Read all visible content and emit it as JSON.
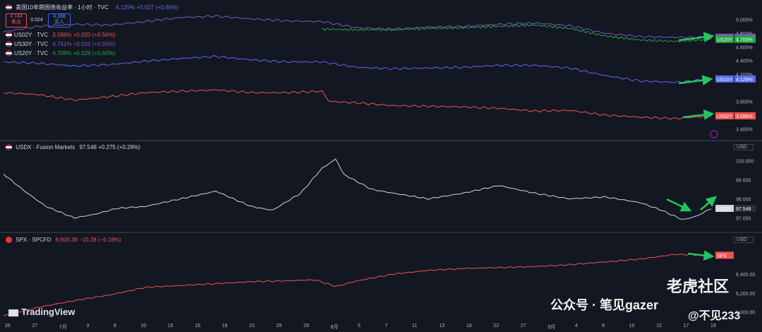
{
  "panels": [
    {
      "id": "yields",
      "legend_main": "美国10年期国债收益率 · 1小时 · TVC",
      "legend_main_value": "4.129% +0.027 (+0.66%)",
      "sell_price": "4.144",
      "sell_label": "卖出",
      "spread": "0.024",
      "buy_price": "4.168",
      "buy_label": "买入",
      "subs": [
        {
          "symbol": "US02Y · TVC",
          "value": "3.586% +0.020 (+0.56%)",
          "color": "#ef5350"
        },
        {
          "symbol": "US30Y · TVC",
          "value": "4.741% +0.026 (+0.55%)",
          "color": "#7e57c2"
        },
        {
          "symbol": "US20Y · TVC",
          "value": "4.709% +0.028 (+0.60%)",
          "color": "#26a641"
        }
      ]
    },
    {
      "id": "usdx",
      "legend_main": "USDX · Fusion Markets",
      "legend_main_value": "97.548 +0.275 (+0.28%)",
      "currency": "USD"
    },
    {
      "id": "spx",
      "legend_main": "SPX · SPCFD",
      "legend_main_value": "6,600.36 −10.28 (−0.16%)",
      "currency": "USD"
    }
  ],
  "chart_data": [
    {
      "type": "line",
      "title": "美国10年期国债收益率 · 1小时 · TVC",
      "ylim": [
        3.3,
        5.1
      ],
      "y_ticks": [
        "5.000%",
        "4.800%",
        "4.600%",
        "4.400%",
        "4.200%",
        "3.800%",
        "3.400%"
      ],
      "series": [
        {
          "name": "US30Y",
          "color": "#7e57c2",
          "last_label": "4.741%",
          "x": [
            0,
            0.05,
            0.1,
            0.15,
            0.2,
            0.25,
            0.3,
            0.35,
            0.4,
            0.45,
            0.5,
            0.55,
            0.6,
            0.65,
            0.7,
            0.75,
            0.8,
            0.85,
            0.9,
            0.95,
            1
          ],
          "y": [
            4.82,
            4.9,
            4.93,
            4.92,
            4.97,
            5.03,
            5.05,
            5.01,
            4.98,
            4.97,
            4.88,
            4.86,
            4.89,
            4.9,
            4.93,
            4.95,
            4.91,
            4.8,
            4.75,
            4.74,
            4.74
          ]
        },
        {
          "name": "US20Y",
          "color": "#26a641",
          "last_label": "4.709%",
          "x": [
            0.45,
            0.5,
            0.55,
            0.6,
            0.65,
            0.7,
            0.75,
            0.8,
            0.85,
            0.9,
            0.95,
            1
          ],
          "y": [
            4.86,
            4.85,
            4.85,
            4.87,
            4.88,
            4.9,
            4.92,
            4.87,
            4.76,
            4.7,
            4.68,
            4.71
          ]
        },
        {
          "name": "US10Y",
          "color": "#5b6cf0",
          "last_label": "4.129%",
          "x": [
            0,
            0.05,
            0.1,
            0.15,
            0.2,
            0.25,
            0.3,
            0.35,
            0.4,
            0.45,
            0.5,
            0.55,
            0.6,
            0.65,
            0.7,
            0.75,
            0.8,
            0.85,
            0.9,
            0.95,
            1
          ],
          "y": [
            4.38,
            4.36,
            4.32,
            4.34,
            4.39,
            4.43,
            4.46,
            4.41,
            4.38,
            4.38,
            4.3,
            4.28,
            4.29,
            4.3,
            4.33,
            4.33,
            4.29,
            4.18,
            4.1,
            4.08,
            4.13
          ]
        },
        {
          "name": "US02Y",
          "color": "#ef5350",
          "last_label": "3.586%",
          "x": [
            0,
            0.05,
            0.1,
            0.15,
            0.2,
            0.25,
            0.3,
            0.35,
            0.4,
            0.45,
            0.46,
            0.5,
            0.55,
            0.6,
            0.65,
            0.7,
            0.75,
            0.8,
            0.85,
            0.9,
            0.95,
            1
          ],
          "y": [
            3.93,
            3.9,
            3.82,
            3.87,
            3.93,
            3.95,
            3.97,
            3.93,
            3.93,
            3.95,
            3.8,
            3.78,
            3.74,
            3.73,
            3.72,
            3.7,
            3.66,
            3.67,
            3.6,
            3.57,
            3.55,
            3.59
          ]
        }
      ]
    },
    {
      "type": "line",
      "title": "USDX · Fusion Markets",
      "ylim": [
        96.5,
        100.5
      ],
      "y_ticks": [
        "100.000",
        "99.000",
        "98.000",
        "97.000"
      ],
      "series": [
        {
          "name": "USDX",
          "color": "#d1d4dc",
          "last_label": "97.548",
          "x": [
            0,
            0.03,
            0.06,
            0.1,
            0.13,
            0.16,
            0.2,
            0.25,
            0.3,
            0.35,
            0.38,
            0.42,
            0.45,
            0.47,
            0.48,
            0.52,
            0.55,
            0.6,
            0.65,
            0.7,
            0.75,
            0.8,
            0.85,
            0.9,
            0.93,
            0.96,
            0.98,
            1
          ],
          "y": [
            99.3,
            98.4,
            97.6,
            97.0,
            97.2,
            97.5,
            97.6,
            98.0,
            98.4,
            97.6,
            97.4,
            98.3,
            99.6,
            100.1,
            99.3,
            98.5,
            98.3,
            98.0,
            98.3,
            98.7,
            98.3,
            98.0,
            98.1,
            97.8,
            97.4,
            96.9,
            97.1,
            97.5
          ]
        }
      ]
    },
    {
      "type": "line",
      "title": "SPX · SPCFD",
      "ylim": [
        5900,
        6700
      ],
      "y_ticks": [
        "6,400.00",
        "6,200.00",
        "6,000.00"
      ],
      "series": [
        {
          "name": "SPX",
          "color": "#ef5350",
          "last_label": "SPX",
          "x": [
            0,
            0.05,
            0.1,
            0.15,
            0.2,
            0.25,
            0.3,
            0.35,
            0.4,
            0.44,
            0.47,
            0.5,
            0.55,
            0.6,
            0.65,
            0.7,
            0.75,
            0.8,
            0.85,
            0.9,
            0.95,
            1
          ],
          "y": [
            5960,
            6050,
            6120,
            6180,
            6260,
            6280,
            6300,
            6320,
            6330,
            6340,
            6270,
            6330,
            6400,
            6440,
            6460,
            6470,
            6480,
            6500,
            6530,
            6560,
            6610,
            6600
          ]
        }
      ]
    }
  ],
  "x_axis_labels": [
    "25",
    "27",
    "7月",
    "3",
    "8",
    "10",
    "15",
    "16",
    "18",
    "23",
    "25",
    "29",
    "8月",
    "5",
    "7",
    "11",
    "13",
    "18",
    "22",
    "27",
    "9月",
    "4",
    "8",
    "10",
    "12",
    "17",
    "19"
  ],
  "watermark_logo": "TradingView",
  "watermark_wechat": "公众号 · 笔见gazer",
  "watermark_tiger": "老虎社区",
  "watermark_user": "@不见233"
}
